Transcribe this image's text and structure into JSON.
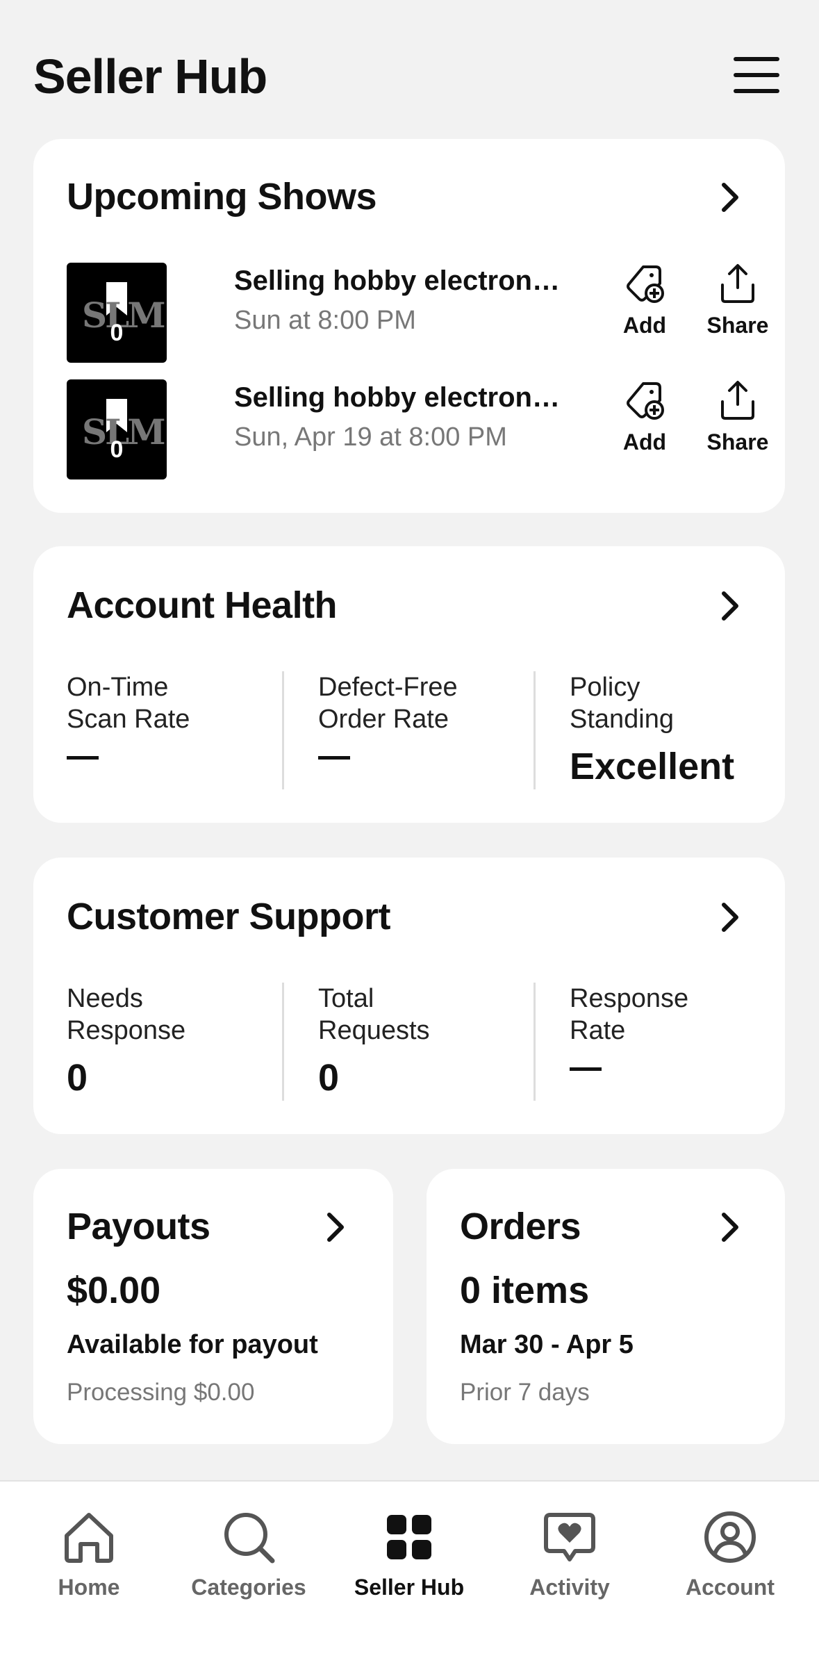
{
  "header": {
    "title": "Seller Hub",
    "menu_icon": "hamburger-menu-icon"
  },
  "upcoming_shows": {
    "title": "Upcoming Shows",
    "shows": [
      {
        "title": "Selling hobby electronics",
        "time": "Sun at 8:00 PM",
        "thumb_count": "0",
        "add_label": "Add",
        "share_label": "Share"
      },
      {
        "title": "Selling hobby electronics",
        "time": "Sun, Apr 19 at 8:00 PM",
        "thumb_count": "0",
        "add_label": "Add",
        "share_label": "Share"
      }
    ]
  },
  "account_health": {
    "title": "Account Health",
    "metrics": [
      {
        "label_line1": "On-Time",
        "label_line2": "Scan Rate"
      },
      {
        "label_line1": "Defect-Free",
        "label_line2": "Order Rate"
      },
      {
        "label_line1": "Policy",
        "label_line2": "Standing",
        "value": "Excellent"
      }
    ]
  },
  "customer_support": {
    "title": "Customer Support",
    "metrics": [
      {
        "label_line1": "Needs",
        "label_line2": "Response",
        "value": "0"
      },
      {
        "label_line1": "Total",
        "label_line2": "Requests",
        "value": "0"
      },
      {
        "label_line1": "Response",
        "label_line2": "Rate"
      }
    ]
  },
  "payouts": {
    "title": "Payouts",
    "amount": "$0.00",
    "subtitle": "Available for payout",
    "note": "Processing $0.00"
  },
  "orders": {
    "title": "Orders",
    "count": "0 items",
    "range": "Mar 30 - Apr 5",
    "note": "Prior 7 days"
  },
  "nav": {
    "active": "Seller Hub",
    "items": [
      {
        "label": "Home",
        "icon": "home-icon"
      },
      {
        "label": "Categories",
        "icon": "search-icon"
      },
      {
        "label": "Seller Hub",
        "icon": "grid-icon"
      },
      {
        "label": "Activity",
        "icon": "heart-chat-icon"
      },
      {
        "label": "Account",
        "icon": "account-icon"
      }
    ]
  }
}
